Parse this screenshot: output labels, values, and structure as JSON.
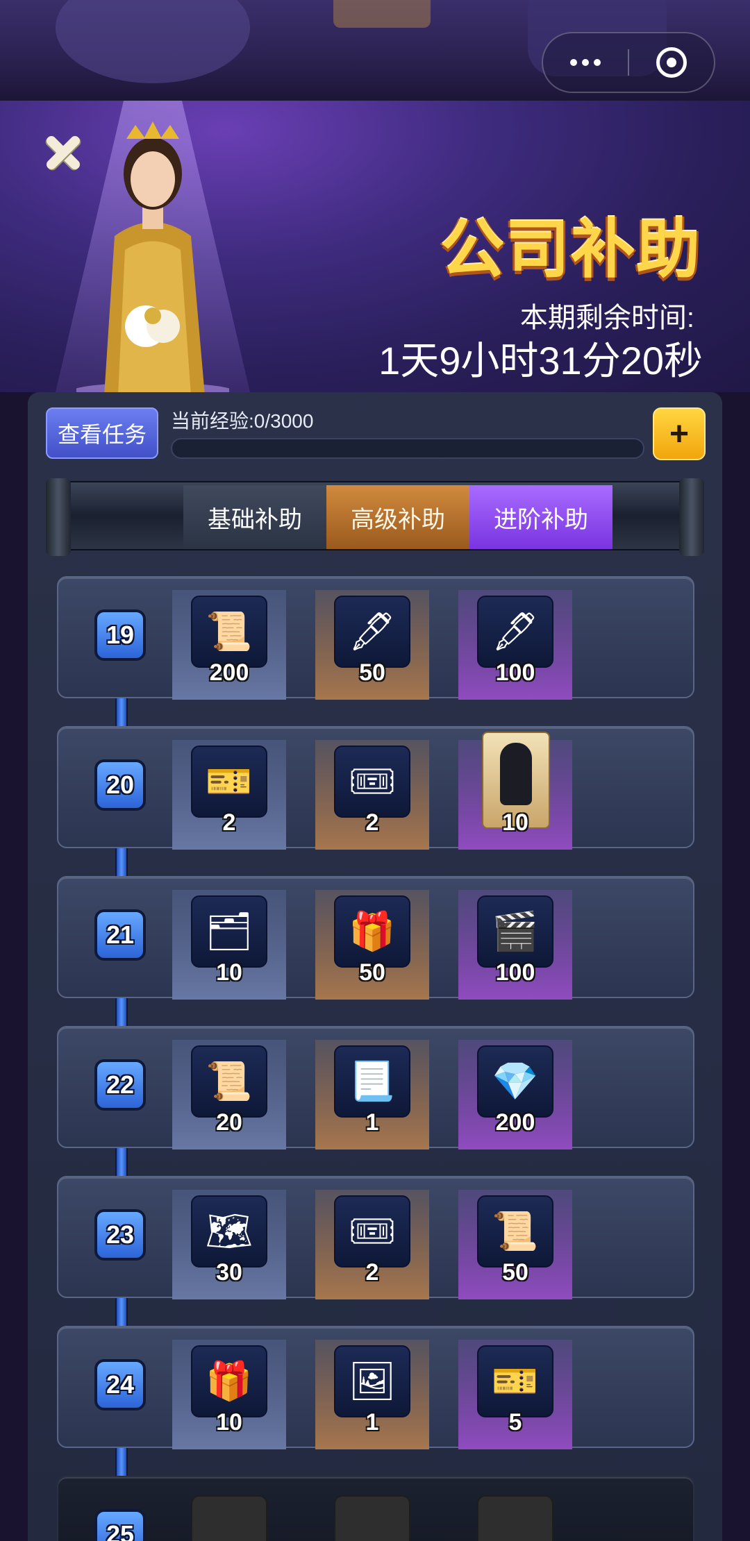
{
  "header": {
    "title": "公司补助",
    "remain_label": "本期剩余时间:",
    "remain_time": "1天9小时31分20秒"
  },
  "panel": {
    "task_button": "查看任务",
    "exp_label": "当前经验:0/3000",
    "exp_progress": 0,
    "plus_label": "+"
  },
  "tabs": [
    "基础补助",
    "高级补助",
    "进阶补助"
  ],
  "rows": [
    {
      "level": "19",
      "rewards": [
        {
          "icon": "contract-icon",
          "glyph": "📜",
          "qty": "200"
        },
        {
          "icon": "ink-quill-icon",
          "glyph": "🖋",
          "qty": "50"
        },
        {
          "icon": "ink-quill-icon",
          "glyph": "🖋",
          "qty": "100"
        }
      ]
    },
    {
      "level": "20",
      "rewards": [
        {
          "icon": "orange-ticket-icon",
          "glyph": "🎫",
          "qty": "2"
        },
        {
          "icon": "mystery-ticket-icon",
          "glyph": "🎟",
          "qty": "2"
        },
        {
          "icon": "character-card-icon",
          "glyph": "",
          "qty": "10"
        }
      ]
    },
    {
      "level": "21",
      "rewards": [
        {
          "icon": "blue-cards-icon",
          "glyph": "🗂",
          "qty": "10"
        },
        {
          "icon": "gift-box-icon",
          "glyph": "🎁",
          "qty": "50"
        },
        {
          "icon": "clapperboard-icon",
          "glyph": "🎬",
          "qty": "100"
        }
      ]
    },
    {
      "level": "22",
      "rewards": [
        {
          "icon": "work-order-icon",
          "glyph": "📜",
          "qty": "20"
        },
        {
          "icon": "scroll-icon",
          "glyph": "📃",
          "qty": "1"
        },
        {
          "icon": "diamond-icon",
          "glyph": "💎",
          "qty": "200"
        }
      ]
    },
    {
      "level": "23",
      "rewards": [
        {
          "icon": "blueprint-icon",
          "glyph": "🗺",
          "qty": "30"
        },
        {
          "icon": "mystery-ticket-icon",
          "glyph": "🎟",
          "qty": "2"
        },
        {
          "icon": "work-order-icon",
          "glyph": "📜",
          "qty": "50"
        }
      ]
    },
    {
      "level": "24",
      "rewards": [
        {
          "icon": "gift-box-icon",
          "glyph": "🎁",
          "qty": "10"
        },
        {
          "icon": "photo-card-icon",
          "glyph": "🖼",
          "qty": "1"
        },
        {
          "icon": "red-tickets-icon",
          "glyph": "🎫",
          "qty": "5"
        }
      ]
    },
    {
      "level": "25",
      "rewards": [
        {
          "icon": "locked-item-icon",
          "glyph": "",
          "qty": ""
        },
        {
          "icon": "locked-item-icon",
          "glyph": "",
          "qty": ""
        },
        {
          "icon": "locked-card-icon",
          "glyph": "",
          "qty": ""
        }
      ]
    }
  ],
  "colors": {
    "accent": "#ffd64a",
    "tab_basic": "#404a5d",
    "tab_advanced": "#c07c34",
    "tab_premium": "#9456f0",
    "level_badge": "#3a78ec"
  }
}
